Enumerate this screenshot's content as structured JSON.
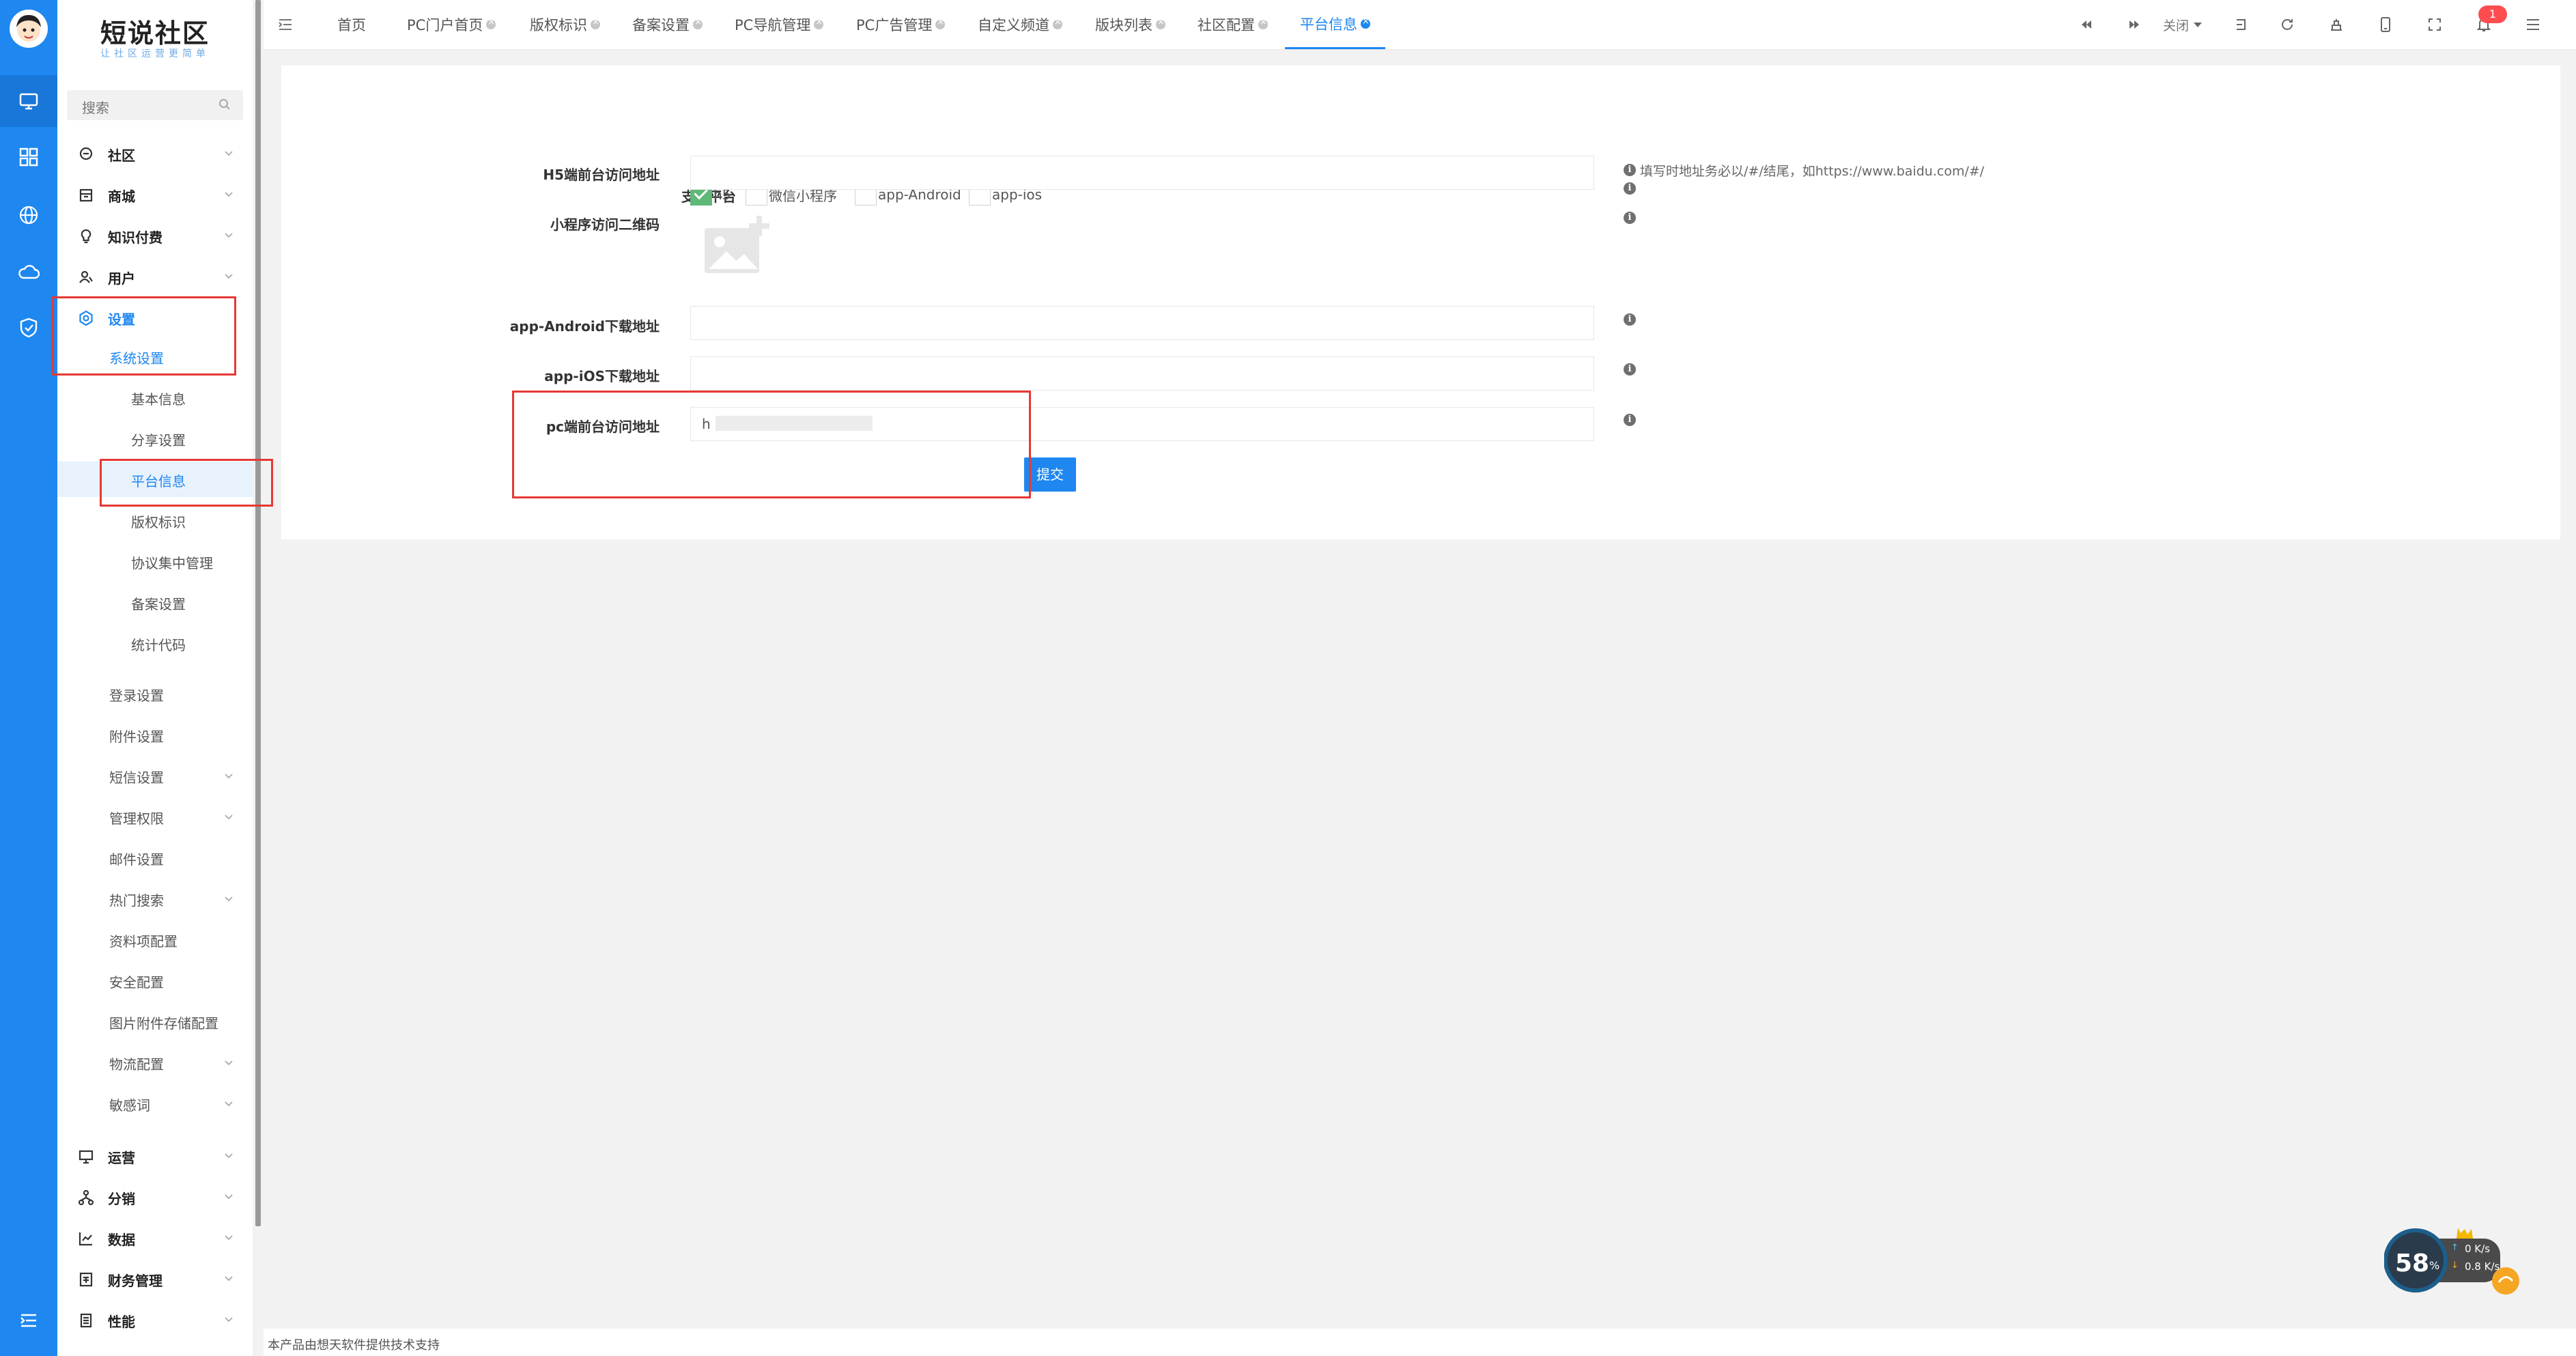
{
  "brand": {
    "title": "短说社区",
    "subtitle": "让社区运营更简单"
  },
  "search": {
    "placeholder": "搜索"
  },
  "nav": {
    "community": "社区",
    "shop": "商城",
    "knowledge": "知识付费",
    "users": "用户",
    "settings": "设置",
    "system_settings": "系统设置",
    "basic_info": "基本信息",
    "share_settings": "分享设置",
    "platform_info": "平台信息",
    "copyright": "版权标识",
    "agreements": "协议集中管理",
    "filing": "备案设置",
    "stats_code": "统计代码",
    "login_settings": "登录设置",
    "attachment_settings": "附件设置",
    "sms_settings": "短信设置",
    "permissions": "管理权限",
    "mail_settings": "邮件设置",
    "hot_search": "热门搜索",
    "profile_config": "资料项配置",
    "security_config": "安全配置",
    "image_storage": "图片附件存储配置",
    "logistics": "物流配置",
    "sensitive_words": "敏感词",
    "operation": "运营",
    "distribution": "分销",
    "data": "数据",
    "finance": "财务管理",
    "performance": "性能"
  },
  "tabs": [
    "首页",
    "PC门户首页",
    "版权标识",
    "备案设置",
    "PC导航管理",
    "PC广告管理",
    "自定义频道",
    "版块列表",
    "社区配置",
    "平台信息"
  ],
  "toolbar": {
    "close_label": "关闭",
    "notification_count": "1"
  },
  "form": {
    "platforms_label": "支持平台",
    "platforms": [
      {
        "label": "h5",
        "checked": true
      },
      {
        "label": "微信小程序",
        "checked": false
      },
      {
        "label": "app-Android",
        "checked": false
      },
      {
        "label": "app-ios",
        "checked": false
      }
    ],
    "h5_url_label": "H5端前台访问地址",
    "h5_url_hint": "填写时地址务必以/#/结尾，如https://www.baidu.com/#/",
    "qrcode_label": "小程序访问二维码",
    "android_label": "app-Android下载地址",
    "ios_label": "app-iOS下载地址",
    "pc_url_label": "pc端前台访问地址",
    "pc_url_value": "h",
    "submit_label": "提交"
  },
  "footer": {
    "text": "本产品由想天软件提供技术支持"
  },
  "net_widget": {
    "percent": "58",
    "up": "0 K/s",
    "down": "0.8 K/s"
  },
  "colors": {
    "primary": "#1e87f0",
    "rail": "#1e87f0",
    "check": "#5fb878",
    "highlight": "#e53935"
  }
}
